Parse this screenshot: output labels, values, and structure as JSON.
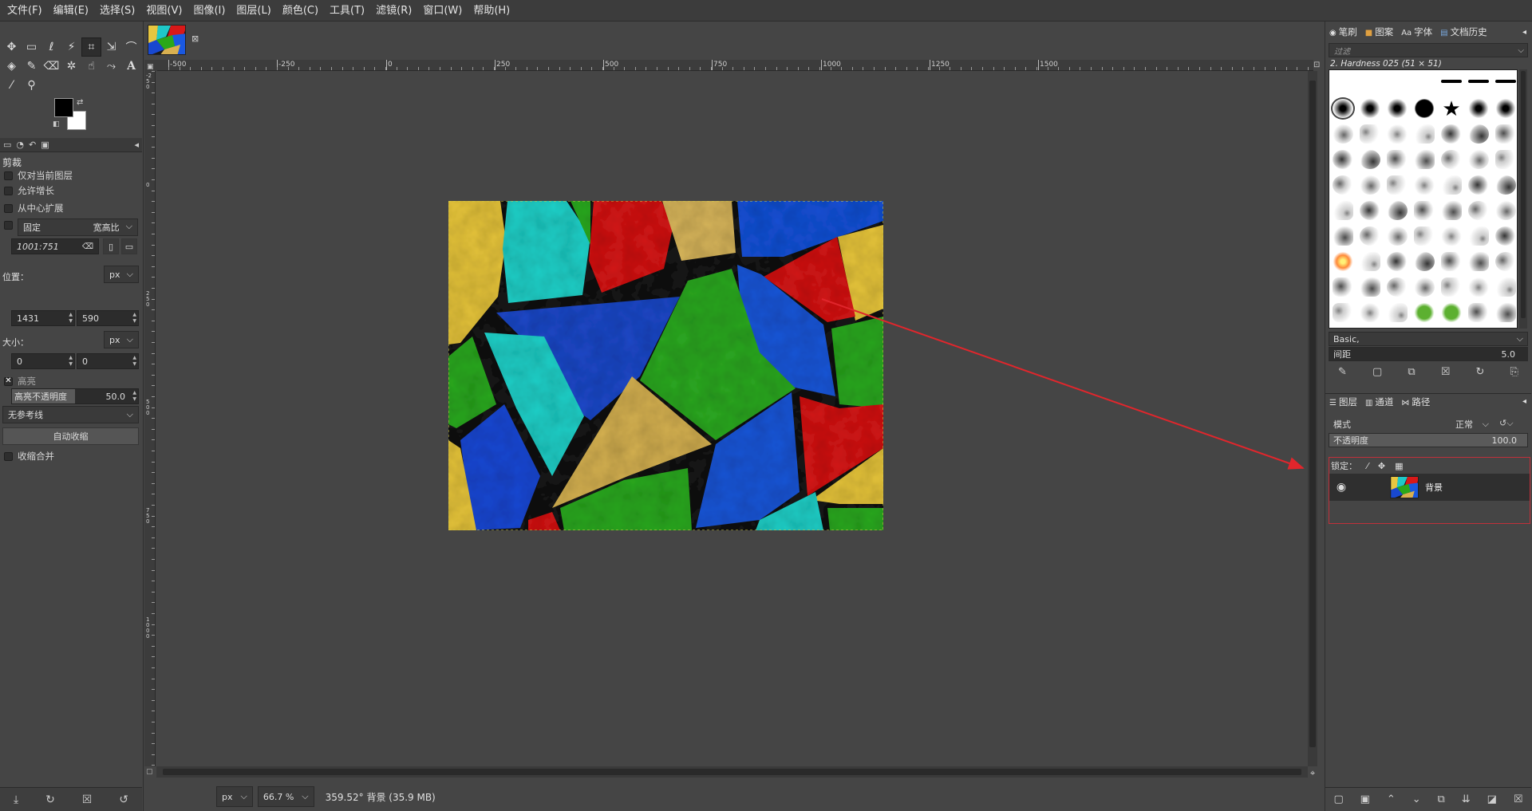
{
  "menubar": {
    "items": [
      "文件(F)",
      "编辑(E)",
      "选择(S)",
      "视图(V)",
      "图像(I)",
      "图层(L)",
      "颜色(C)",
      "工具(T)",
      "滤镜(R)",
      "窗口(W)",
      "帮助(H)"
    ]
  },
  "toolbox": {
    "tool_icons": [
      "move-tool",
      "rect-select-tool",
      "free-select-tool",
      "fuzzy-select-tool",
      "crop-tool",
      "transform-tool",
      "warp-tool",
      "bucket-fill-tool",
      "paintbrush-tool",
      "eraser-tool",
      "clone-tool",
      "smudge-tool",
      "paths-tool",
      "text-tool",
      "color-picker-tool",
      "zoom-tool"
    ],
    "fg_color": "#000000",
    "bg_color": "#ffffff"
  },
  "tool_options": {
    "title": "剪裁",
    "only_current_layer": "仅对当前图层",
    "allow_growing": "允许增长",
    "expand_from_center": "从中心扩展",
    "fixed_label": "固定",
    "fixed_mode": "宽高比",
    "ratio_value": "1001:751",
    "position_label": "位置：",
    "position_unit": "px",
    "position_x": "1431",
    "position_y": "590",
    "size_label": "大小：",
    "size_unit": "px",
    "size_w": "0",
    "size_h": "0",
    "highlight_label": "高亮",
    "highlight_opacity_label": "高亮不透明度",
    "highlight_opacity_value": "50.0",
    "guides": "无参考线",
    "auto_shrink": "自动收缩",
    "shrink_merged": "收缩合并"
  },
  "rulers": {
    "h_labels": [
      "-500",
      "-250",
      "0",
      "250",
      "500",
      "750",
      "1000",
      "1250",
      "1500"
    ],
    "v_labels": [
      "-250",
      "0",
      "250",
      "500",
      "750",
      "1000"
    ]
  },
  "statusbar": {
    "unit": "px",
    "zoom": "66.7 %",
    "text": "359.52° 背景 (35.9 MB)"
  },
  "dock": {
    "top_tabs": [
      "笔刷",
      "图案",
      "字体",
      "文档历史"
    ],
    "filter_placeholder": "过滤",
    "brush_name": "2. Hardness 025 (51 × 51)",
    "brush_set": "Basic,",
    "spacing_label": "间距",
    "spacing_value": "5.0",
    "layer_tabs": [
      "图层",
      "通道",
      "路径"
    ],
    "mode_label": "模式",
    "mode_value": "正常",
    "opacity_label": "不透明度",
    "opacity_value": "100.0",
    "lock_label": "锁定：",
    "layer_name": "背景"
  },
  "colors": {
    "annotation_arrow": "#e0262c",
    "highlight_box": "#c0303a"
  }
}
